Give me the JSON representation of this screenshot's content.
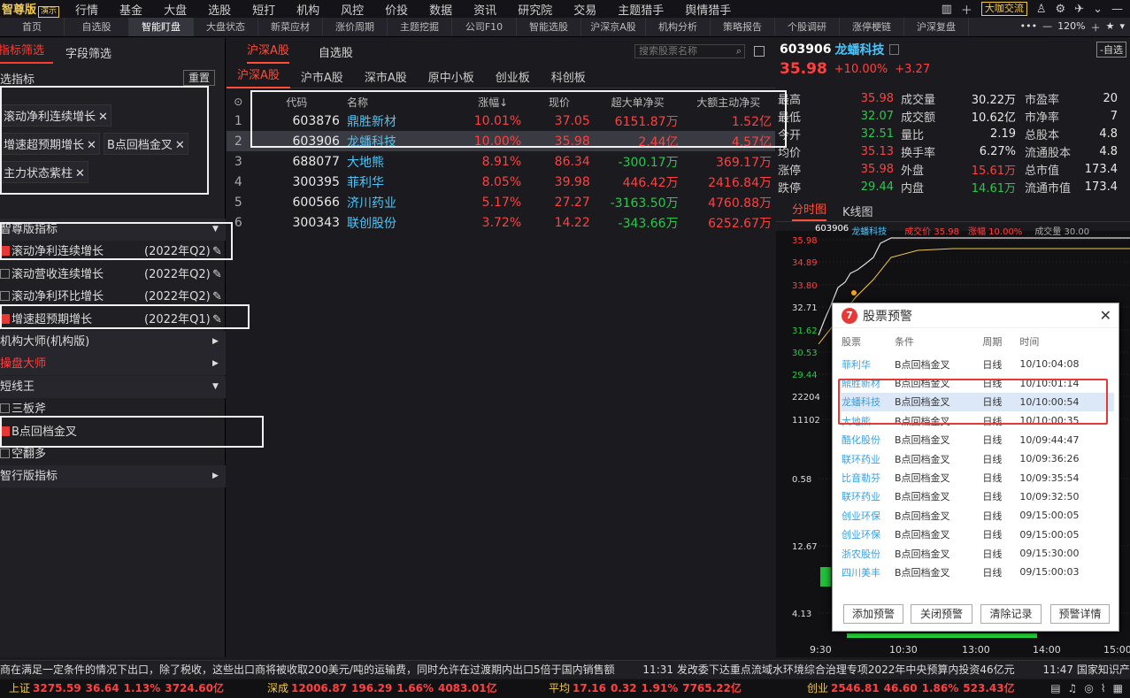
{
  "menubar": {
    "brand": "智尊版",
    "brand_badge": "演示",
    "items": [
      "行情",
      "基金",
      "大盘",
      "选股",
      "短打",
      "机构",
      "风控",
      "价投",
      "数据",
      "资讯",
      "研究院",
      "交易",
      "主题猎手",
      "舆情猎手"
    ],
    "right_btn": "大咖交流"
  },
  "tabs": {
    "items": [
      "首页",
      "自选股",
      "智能盯盘",
      "大盘状态",
      "新菜应材",
      "涨价周期",
      "主题挖掘",
      "公司F10",
      "智能选股",
      "沪深京A股",
      "机构分析",
      "策略报告",
      "个股调研",
      "涨停梗链",
      "沪深复盘"
    ],
    "active": "智能盯盘",
    "zoom": "120%"
  },
  "left": {
    "tab1": "指标筛选",
    "tab2": "字段筛选",
    "selected_title": "选指标",
    "reset_btn": "重置",
    "chips": [
      "滚动净利连续增长",
      "增速超预期增长",
      "B点回档金叉",
      "主力状态紫柱"
    ],
    "rows": [
      {
        "label": "智尊版指标",
        "type": "group",
        "arrow": "▼"
      },
      {
        "label": "滚动净利连续增长",
        "type": "check",
        "checked": true,
        "date": "(2022年Q2)"
      },
      {
        "label": "滚动营收连续增长",
        "type": "check",
        "checked": false,
        "date": "(2022年Q2)"
      },
      {
        "label": "滚动净利环比增长",
        "type": "check",
        "checked": false,
        "date": "(2022年Q2)"
      },
      {
        "label": "增速超预期增长",
        "type": "check",
        "checked": true,
        "date": "(2022年Q1)"
      },
      {
        "label": "机构大师(机构版)",
        "type": "group",
        "arrow": "▶"
      },
      {
        "label": "操盘大师",
        "type": "group-red",
        "arrow": "▶"
      },
      {
        "label": "短线王",
        "type": "group",
        "arrow": "▼"
      },
      {
        "label": "三板斧",
        "type": "check",
        "checked": false,
        "date": ""
      },
      {
        "label": "B点回档金叉",
        "type": "check",
        "checked": true,
        "date": ""
      },
      {
        "label": "空翻多",
        "type": "check",
        "checked": false,
        "date": ""
      },
      {
        "label": "智行版指标",
        "type": "group",
        "arrow": "▶"
      }
    ]
  },
  "mid": {
    "tab1": "沪深A股",
    "tab2": "自选股",
    "search_placeholder": "搜索股票名称",
    "subtabs": [
      "沪深A股",
      "沪市A股",
      "深市A股",
      "原中小板",
      "创业板",
      "科创板"
    ],
    "headers": [
      "代码",
      "名称",
      "涨幅↓",
      "现价",
      "超大单净买",
      "大额主动净买"
    ],
    "rows": [
      {
        "idx": "1",
        "code": "603876",
        "name": "鼎胜新材",
        "chg": "10.01%",
        "price": "37.05",
        "big": "6151.87万",
        "main": "1.52亿",
        "bigc": "r",
        "mainc": "r"
      },
      {
        "idx": "2",
        "code": "603906",
        "name": "龙蟠科技",
        "chg": "10.00%",
        "price": "35.98",
        "big": "2.44亿",
        "main": "4.57亿",
        "bigc": "r",
        "mainc": "r"
      },
      {
        "idx": "3",
        "code": "688077",
        "name": "大地熊",
        "chg": "8.91%",
        "price": "86.34",
        "big": "-300.17万",
        "main": "369.17万",
        "bigc": "g",
        "mainc": "r"
      },
      {
        "idx": "4",
        "code": "300395",
        "name": "菲利华",
        "chg": "8.05%",
        "price": "39.98",
        "big": "446.42万",
        "main": "2416.84万",
        "bigc": "r",
        "mainc": "r"
      },
      {
        "idx": "5",
        "code": "600566",
        "name": "济川药业",
        "chg": "5.17%",
        "price": "27.27",
        "big": "-3163.50万",
        "main": "4760.88万",
        "bigc": "g",
        "mainc": "r"
      },
      {
        "idx": "6",
        "code": "300343",
        "name": "联创股份",
        "chg": "3.72%",
        "price": "14.22",
        "big": "-343.66万",
        "main": "6252.67万",
        "bigc": "g",
        "mainc": "r"
      }
    ]
  },
  "right": {
    "code": "603906",
    "name": "龙蟠科技",
    "price": "35.98",
    "pct": "+10.00%",
    "chg": "+3.27",
    "btn": "-自选",
    "quote": [
      [
        "最高",
        "35.98",
        "r",
        "成交量",
        "30.22万",
        "w",
        "市盈率",
        "20"
      ],
      [
        "最低",
        "32.07",
        "g",
        "成交额",
        "10.62亿",
        "w",
        "市净率",
        "7"
      ],
      [
        "今开",
        "32.51",
        "g",
        "量比",
        "2.19",
        "w",
        "总股本",
        "4.8"
      ],
      [
        "均价",
        "35.13",
        "r",
        "换手率",
        "6.27%",
        "w",
        "流通股本",
        "4.8"
      ],
      [
        "涨停",
        "35.98",
        "r",
        "外盘",
        "15.61万",
        "r",
        "总市值",
        "173.4"
      ],
      [
        "跌停",
        "29.44",
        "g",
        "内盘",
        "14.61万",
        "g",
        "流通市值",
        "173.4"
      ]
    ],
    "chart_tab1": "分时图",
    "chart_tab2": "K线图",
    "chart_info": {
      "code": "603906",
      "name": "龙蟠科技",
      "price_label": "成交价 35.98",
      "pct_label": "涨幅 10.00%",
      "vol_label": "成交量 30.00"
    },
    "ylabels": [
      "35.98",
      "34.89",
      "33.80",
      "32.71",
      "31.62",
      "30.53",
      "29.44",
      "22204",
      "11102",
      "0.58",
      "12.67",
      "4.13"
    ],
    "xlabels": [
      "9:30",
      "10:30",
      "13:00",
      "14:00",
      "15:00"
    ]
  },
  "dialog": {
    "title": "股票预警",
    "close": "✕",
    "headers": [
      "股票",
      "条件",
      "周期",
      "时间"
    ],
    "rows": [
      [
        "菲利华",
        "B点回档金叉",
        "日线",
        "10/10:04:08"
      ],
      [
        "鼎胜新材",
        "B点回档金叉",
        "日线",
        "10/10:01:14"
      ],
      [
        "龙蟠科技",
        "B点回档金叉",
        "日线",
        "10/10:00:54"
      ],
      [
        "大地熊",
        "B点回档金叉",
        "日线",
        "10/10:00:35"
      ],
      [
        "酷化股份",
        "B点回档金叉",
        "日线",
        "10/09:44:47"
      ],
      [
        "联环药业",
        "B点回档金叉",
        "日线",
        "10/09:36:26"
      ],
      [
        "比音勒芬",
        "B点回档金叉",
        "日线",
        "10/09:35:54"
      ],
      [
        "联环药业",
        "B点回档金叉",
        "日线",
        "10/09:32:50"
      ],
      [
        "创业环保",
        "B点回档金叉",
        "日线",
        "09/15:00:05"
      ],
      [
        "创业环保",
        "B点回档金叉",
        "日线",
        "09/15:00:05"
      ],
      [
        "浙农股份",
        "B点回档金叉",
        "日线",
        "09/15:30:00"
      ],
      [
        "四川美丰",
        "B点回档金叉",
        "日线",
        "09/15:00:03"
      ]
    ],
    "buttons": [
      "添加预警",
      "关闭预警",
      "清除记录",
      "预警详情"
    ]
  },
  "ticker": {
    "text1": "商在满足一定条件的情况下出口，除了税收，这些出口商将被收取200美元/吨的运输费，同时允许在过渡期内出口5倍于国内销售额",
    "text2": "11:31 发改委下达重点流域水环境综合治理专项2022年中央预算内投资46亿元",
    "text3": "11:47 国家知识产权局："
  },
  "status": [
    {
      "name": "上证",
      "v": "3275.59",
      "c": "36.64",
      "p": "1.13%",
      "a": "3724.60亿"
    },
    {
      "name": "深成",
      "v": "12006.87",
      "c": "196.29",
      "p": "1.66%",
      "a": "4083.01亿"
    },
    {
      "name": "平均",
      "v": "17.16",
      "c": "0.32",
      "p": "1.91%",
      "a": "7765.22亿"
    },
    {
      "name": "创业",
      "v": "2546.81",
      "c": "46.60",
      "p": "1.86%",
      "a": "523.43亿"
    }
  ]
}
